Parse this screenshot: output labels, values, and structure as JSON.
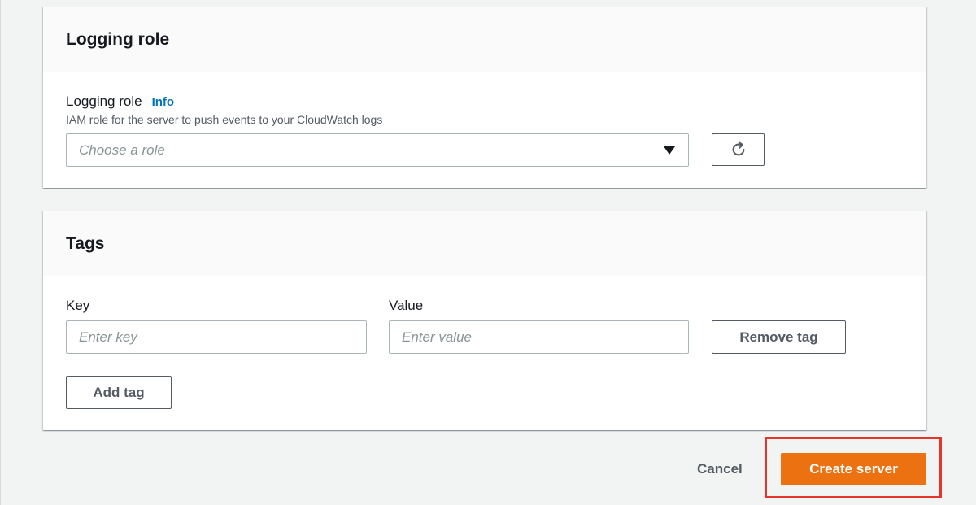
{
  "logging": {
    "section_title": "Logging role",
    "field_label": "Logging role",
    "info_link": "Info",
    "description": "IAM role for the server to push events to your CloudWatch logs",
    "select_placeholder": "Choose a role"
  },
  "tags": {
    "section_title": "Tags",
    "key_label": "Key",
    "value_label": "Value",
    "key_placeholder": "Enter key",
    "value_placeholder": "Enter value",
    "remove_tag_label": "Remove tag",
    "add_tag_label": "Add tag"
  },
  "footer": {
    "cancel_label": "Cancel",
    "create_label": "Create server"
  },
  "icons": {
    "refresh": "refresh-icon",
    "dropdown": "caret-down-icon"
  },
  "colors": {
    "primary_button": "#ec7211",
    "info_link": "#0073bb",
    "highlight_box": "#e8352b"
  }
}
